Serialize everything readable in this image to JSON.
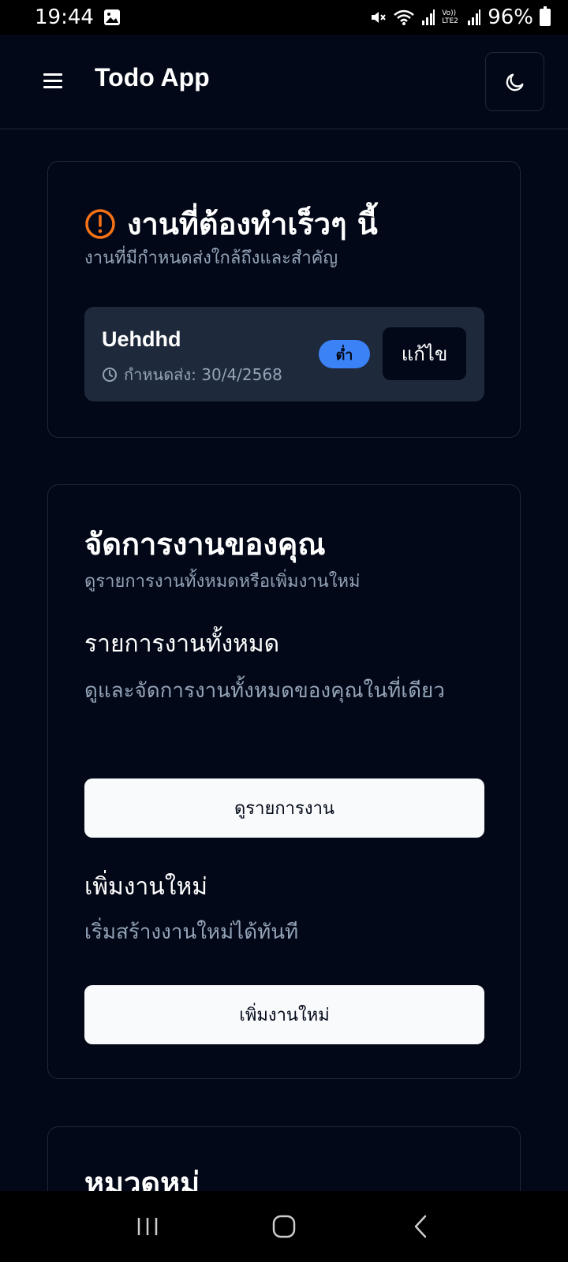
{
  "status": {
    "time": "19:44",
    "battery": "96%",
    "network": "Vo)) LTE2"
  },
  "header": {
    "title": "Todo App",
    "menu_icon": "hamburger-icon",
    "theme_icon": "moon-icon"
  },
  "urgent": {
    "title": "งานที่ต้องทำเร็วๆ นี้",
    "subtitle": "งานที่มีกำหนดส่งใกล้ถึงและสำคัญ",
    "icon": "alert-circle-icon",
    "icon_color": "#f97316",
    "tasks": [
      {
        "name": "Uehdhd",
        "due": "กำหนดส่ง: 30/4/2568",
        "priority": "ต่ำ",
        "priority_color": "#3b82f6",
        "edit_label": "แก้ไข"
      }
    ]
  },
  "manage": {
    "title": "จัดการงานของคุณ",
    "subtitle": "ดูรายการงานทั้งหมดหรือเพิ่มงานใหม่",
    "all_tasks": {
      "title": "รายการงานทั้งหมด",
      "description": "ดูและจัดการงานทั้งหมดของคุณในที่เดียว",
      "button": "ดูรายการงาน"
    },
    "new_task": {
      "title": "เพิ่มงานใหม่",
      "description": "เริ่มสร้างงานใหม่ได้ทันที",
      "button": "เพิ่มงานใหม่"
    }
  },
  "categories": {
    "title": "หมวดหมู่"
  }
}
